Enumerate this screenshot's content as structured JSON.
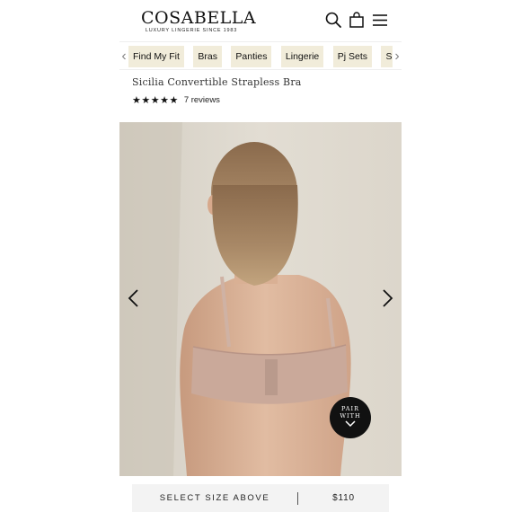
{
  "header": {
    "logo_text": "COSABELLA",
    "logo_tagline": "LUXURY LINGERIE SINCE 1983",
    "icons": [
      "search-icon",
      "bag-icon",
      "menu-icon"
    ]
  },
  "category_nav": {
    "items": [
      {
        "label": "Find My Fit"
      },
      {
        "label": "Bras"
      },
      {
        "label": "Panties"
      },
      {
        "label": "Lingerie"
      },
      {
        "label": "Pj Sets"
      },
      {
        "label": "Sleepw"
      }
    ],
    "prev_icon": "chevron-left-icon",
    "next_icon": "chevron-right-icon"
  },
  "product": {
    "title": "Sicilia Convertible Strapless Bra",
    "stars": "★★★★★",
    "rating_value": 5,
    "reviews_label": "7 reviews"
  },
  "gallery": {
    "image_description_icon": "product-photo",
    "pair_with": {
      "line1": "PAIR",
      "line2": "WITH"
    }
  },
  "footer_bar": {
    "select_label": "SELECT SIZE ABOVE",
    "price": "$110"
  },
  "colors": {
    "pill_bg": "#f1ecda",
    "bar_bg": "#f3f3f3",
    "pair_bg": "#111111"
  }
}
